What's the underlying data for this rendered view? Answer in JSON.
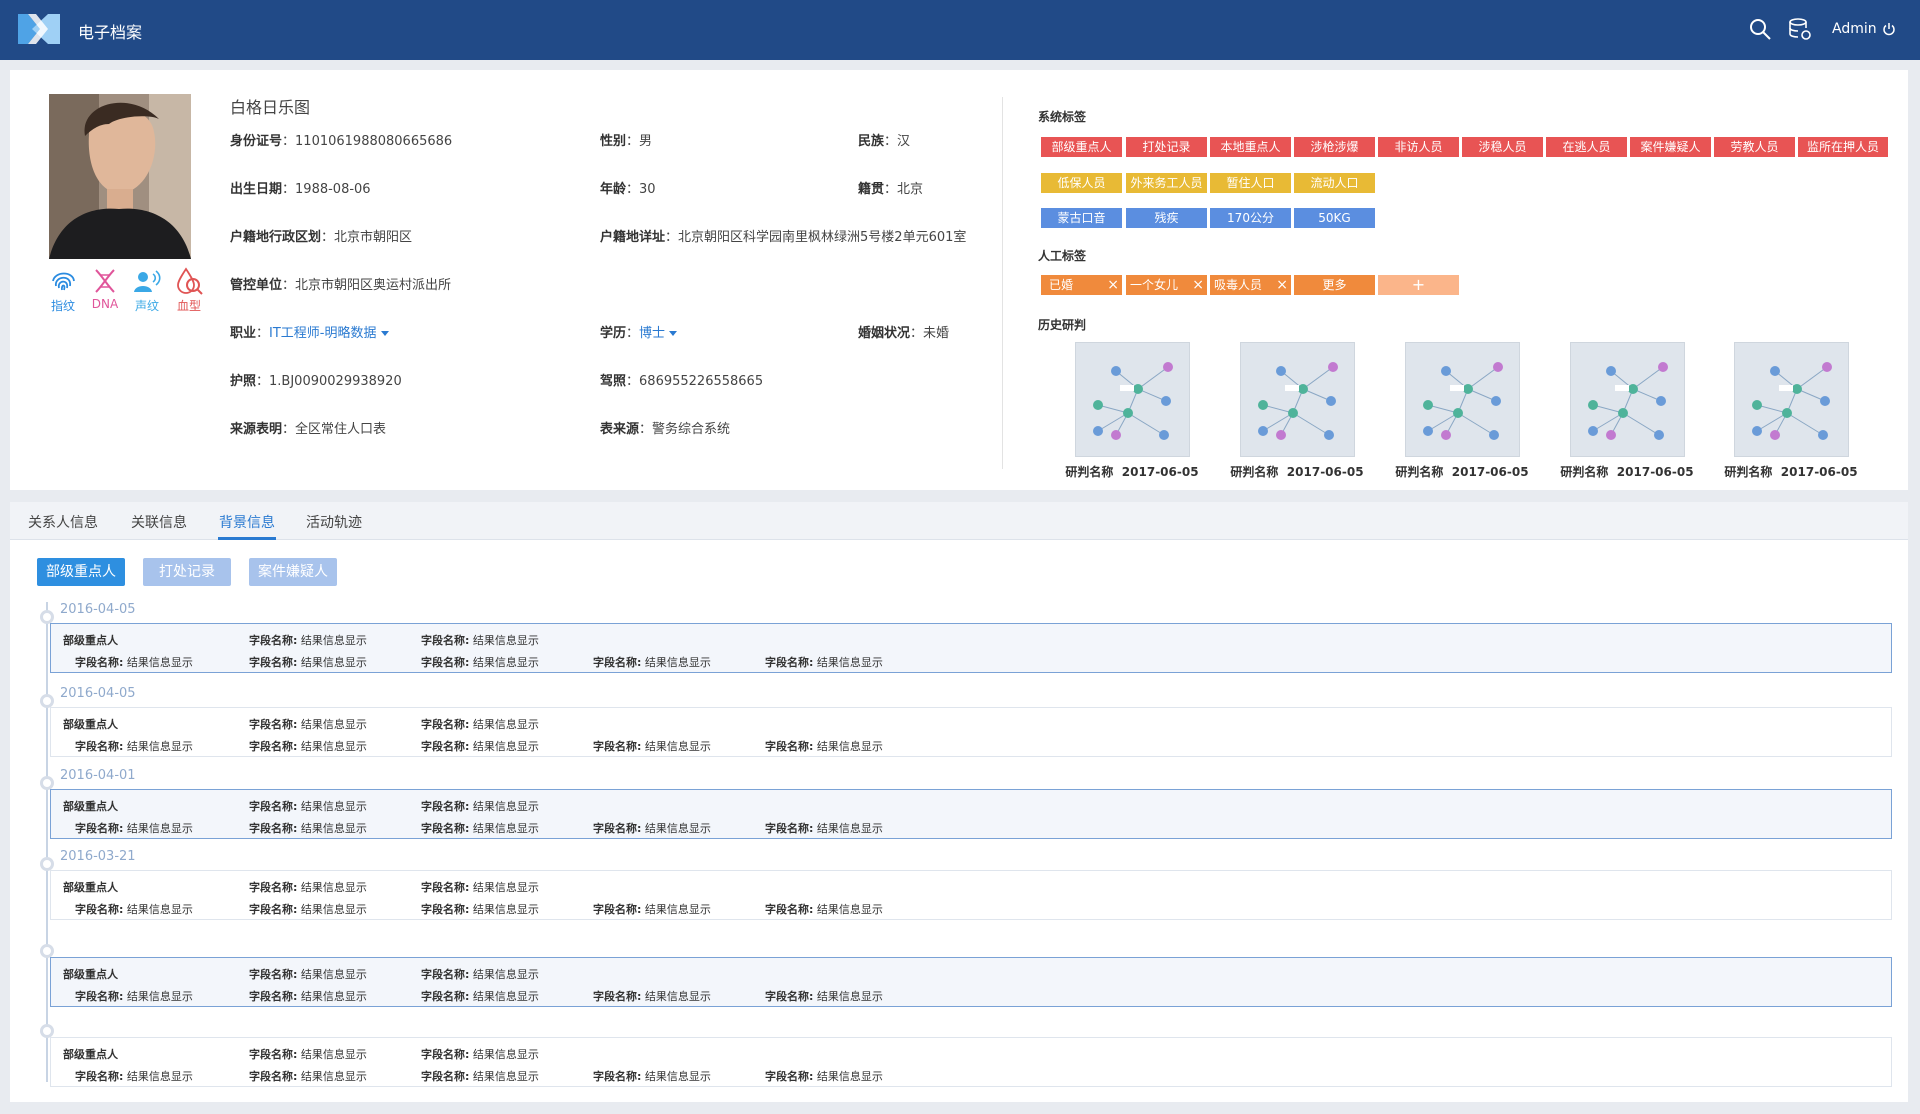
{
  "header": {
    "title": "电子档案",
    "user": "Admin"
  },
  "person": {
    "name": "白格日乐图",
    "biometrics": [
      "指纹",
      "DNA",
      "声纹",
      "血型"
    ],
    "id_label": "身份证号",
    "id_value": "1101061988080665686",
    "gender_label": "性别",
    "gender_value": "男",
    "ethnic_label": "民族",
    "ethnic_value": "汉",
    "dob_label": "出生日期",
    "dob_value": "1988-08-06",
    "age_label": "年龄",
    "age_value": "30",
    "native_label": "籍贯",
    "native_value": "北京",
    "hukou_area_label": "户籍地行政区划",
    "hukou_area_value": "北京市朝阳区",
    "hukou_addr_label": "户籍地详址",
    "hukou_addr_value": "北京朝阳区科学园南里枫林绿洲5号楼2单元601室",
    "ctrl_label": "管控单位",
    "ctrl_value": "北京市朝阳区奥运村派出所",
    "job_label": "职业",
    "job_value": "IT工程师-明略数据",
    "edu_label": "学历",
    "edu_value": "博士",
    "marital_label": "婚姻状况",
    "marital_value": "未婚",
    "passport_label": "护照",
    "passport_value": "1.BJ0090029938920",
    "license_label": "驾照",
    "license_value": "686955226558665",
    "src_label": "来源表明",
    "src_value": "全区常住人口表",
    "tblsrc_label": "表来源",
    "tblsrc_value": "警务综合系统"
  },
  "system_tags": {
    "label": "系统标签",
    "red": [
      "部级重点人",
      "打处记录",
      "本地重点人",
      "涉枪涉爆",
      "非访人员",
      "涉稳人员",
      "在逃人员",
      "案件嫌疑人",
      "劳教人员",
      "监所在押人员"
    ],
    "yellow": [
      "低保人员",
      "外来务工人员",
      "暂住人口",
      "流动人口"
    ],
    "blue": [
      "蒙古口音",
      "残疾",
      "170公分",
      "50KG"
    ]
  },
  "manual_tags": {
    "label": "人工标签",
    "items": [
      "已婚",
      "一个女儿",
      "吸毒人员"
    ],
    "more": "更多",
    "add": "+"
  },
  "history": {
    "label": "历史研判",
    "items": [
      {
        "name": "研判名称",
        "date": "2017-06-05"
      },
      {
        "name": "研判名称",
        "date": "2017-06-05"
      },
      {
        "name": "研判名称",
        "date": "2017-06-05"
      },
      {
        "name": "研判名称",
        "date": "2017-06-05"
      },
      {
        "name": "研判名称",
        "date": "2017-06-05"
      }
    ]
  },
  "tabs": [
    "关系人信息",
    "关联信息",
    "背景信息",
    "活动轨迹"
  ],
  "filters": [
    "部级重点人",
    "打处记录",
    "案件嫌疑人"
  ],
  "timeline": {
    "field_label": "字段名称:",
    "field_value": "结果信息显示",
    "entries": [
      {
        "date": "2016-04-05",
        "title": "部级重点人"
      },
      {
        "date": "2016-04-05",
        "title": "部级重点人"
      },
      {
        "date": "2016-04-01",
        "title": "部级重点人"
      },
      {
        "date": "2016-03-21",
        "title": "部级重点人"
      },
      {
        "date": "",
        "title": "部级重点人"
      },
      {
        "date": "",
        "title": "部级重点人"
      }
    ]
  },
  "colors": {
    "header_bg": "#214a87",
    "accent": "#2a7ad1",
    "tag_red": "#e85454",
    "tag_yellow": "#e8ba35",
    "tag_blue": "#5b8ee0",
    "tag_orange": "#f08a3c"
  }
}
